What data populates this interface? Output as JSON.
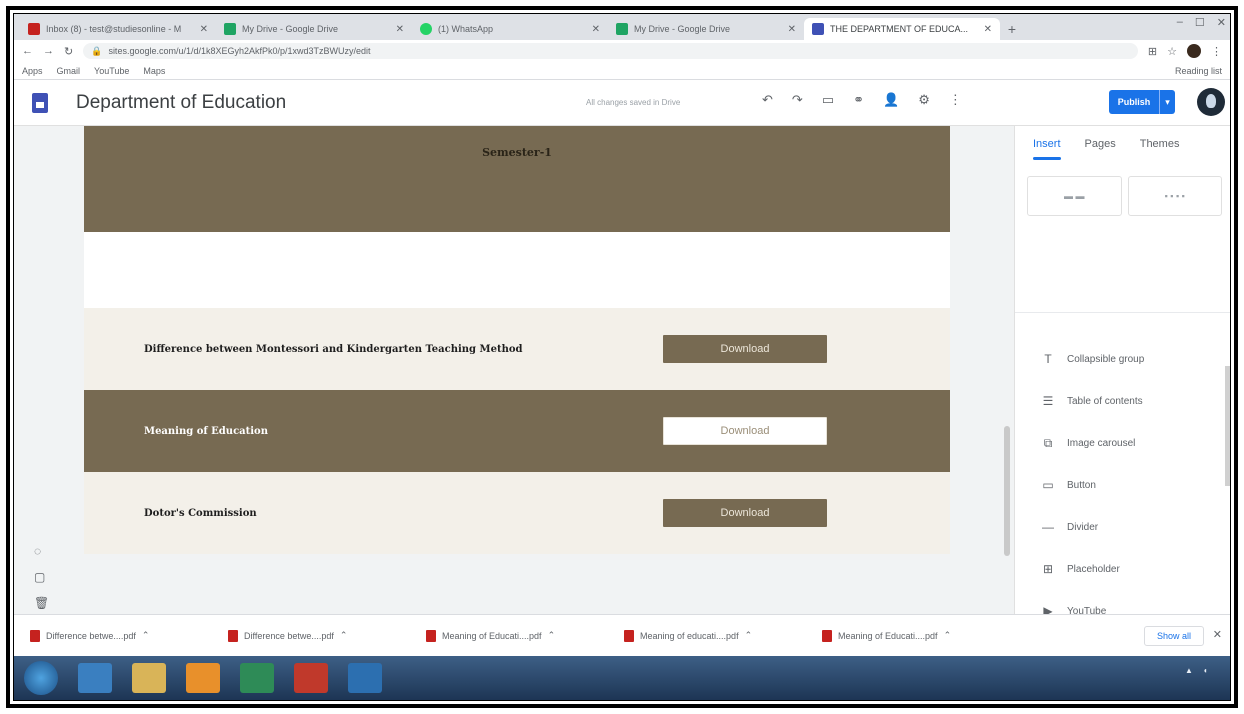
{
  "browser": {
    "tabs": [
      {
        "title": "Inbox (8) - test@studiesonline - M",
        "active": false,
        "color": "#c5221f"
      },
      {
        "title": "My Drive - Google Drive",
        "active": false,
        "color": "#1fa463"
      },
      {
        "title": "(1) WhatsApp",
        "active": false,
        "color": "#25d366"
      },
      {
        "title": "My Drive - Google Drive",
        "active": false,
        "color": "#1fa463"
      },
      {
        "title": "THE DEPARTMENT OF EDUCA...",
        "active": true,
        "color": "#3f51b5"
      }
    ],
    "url": "sites.google.com/u/1/d/1k8XEGyh2AkfPk0/p/1xwd3TzBWUzy/edit",
    "bookmarks": [
      "Apps",
      "Gmail",
      "YouTube",
      "Maps"
    ],
    "bookmarks_right": "Reading list"
  },
  "app": {
    "title": "Department of Education",
    "save_status": "All changes saved in Drive",
    "publish_label": "Publish",
    "accent": "#1a73e8"
  },
  "page": {
    "brand_color": "#776a52",
    "banner_title": "Semester-1",
    "rows": [
      {
        "label": "Difference between Montessori and Kindergarten Teaching Method",
        "button": "Download",
        "style": "light"
      },
      {
        "label": "Meaning of Education",
        "button": "Download",
        "style": "dark"
      },
      {
        "label": "Dotor's Commission",
        "button": "Download",
        "style": "light"
      }
    ]
  },
  "panel": {
    "tabs": [
      "Insert",
      "Pages",
      "Themes"
    ],
    "items": [
      {
        "label": "Collapsible group",
        "icon": "text-icon"
      },
      {
        "label": "Table of contents",
        "icon": "list-icon"
      },
      {
        "label": "Image carousel",
        "icon": "carousel-icon"
      },
      {
        "label": "Button",
        "icon": "button-icon"
      },
      {
        "label": "Divider",
        "icon": "divider-icon"
      },
      {
        "label": "Placeholder",
        "icon": "placeholder-icon"
      },
      {
        "label": "YouTube",
        "icon": "youtube-icon"
      }
    ]
  },
  "downloads": {
    "files": [
      "Difference betwe....pdf",
      "Difference betwe....pdf",
      "Meaning of Educati....pdf",
      "Meaning of educati....pdf",
      "Meaning of Educati....pdf"
    ],
    "show_all": "Show all"
  }
}
